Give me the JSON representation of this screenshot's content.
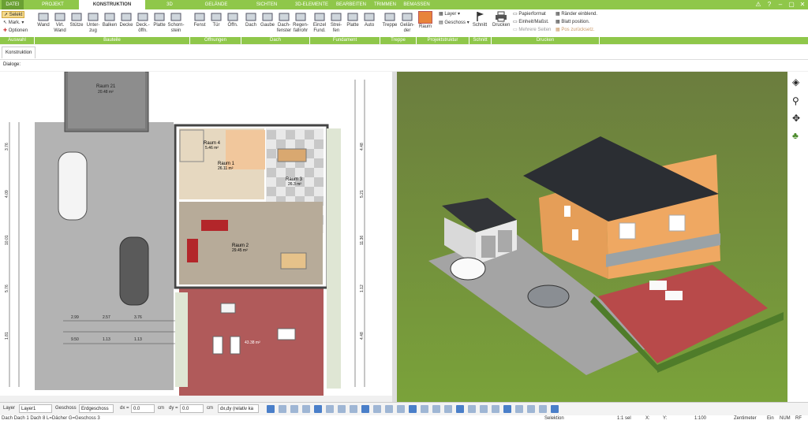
{
  "menu": {
    "tabs": [
      "DATEI",
      "PROJEKT",
      "KONSTRUKTION",
      "3D",
      "GELÄNDE",
      "SICHTEN",
      "3D-ELEMENTE",
      "BEARBEITEN",
      "TRIMMEN",
      "BEMASSEN"
    ],
    "active_tab": "KONSTRUKTION"
  },
  "ribbon": {
    "auswahl": {
      "selekt": "Selekt",
      "mark": "Mark.",
      "optionen": "Optionen"
    },
    "bauteile": [
      {
        "l1": "Wand",
        "l2": ""
      },
      {
        "l1": "Virt.",
        "l2": "Wand"
      },
      {
        "l1": "Stütze",
        "l2": ""
      },
      {
        "l1": "Unter-",
        "l2": "zug"
      },
      {
        "l1": "Balken",
        "l2": ""
      },
      {
        "l1": "Decke",
        "l2": ""
      },
      {
        "l1": "Deck.-",
        "l2": "öffn."
      },
      {
        "l1": "Platte",
        "l2": ""
      },
      {
        "l1": "Schorn-",
        "l2": "stein"
      }
    ],
    "oeffnungen": [
      {
        "l1": "Fenst",
        "l2": ""
      },
      {
        "l1": "Tür",
        "l2": ""
      },
      {
        "l1": "Öffn.",
        "l2": ""
      }
    ],
    "dach": [
      {
        "l1": "Dach",
        "l2": ""
      },
      {
        "l1": "Gaube",
        "l2": ""
      },
      {
        "l1": "Dach-",
        "l2": "fenster"
      },
      {
        "l1": "Regen-",
        "l2": "fallrohr"
      }
    ],
    "fundament": [
      {
        "l1": "Einzel",
        "l2": "Fund."
      },
      {
        "l1": "Strei-",
        "l2": "fen"
      },
      {
        "l1": "Platte",
        "l2": ""
      },
      {
        "l1": "Auto",
        "l2": ""
      }
    ],
    "treppe": [
      {
        "l1": "Treppe",
        "l2": ""
      },
      {
        "l1": "Gelän-",
        "l2": "der"
      }
    ],
    "projektstruktur": {
      "raum": "Raum",
      "layer": "Layer",
      "geschoss": "Geschoss"
    },
    "schnitt": {
      "label": "Schnitt"
    },
    "drucken": {
      "drucken": "Drucken",
      "papierformat": "Papierformat",
      "einheit": "Einheit/Maßst.",
      "mehrere": "Mehrere Seiten",
      "raender": "Ränder einblend.",
      "blatt": "Blatt position.",
      "pos": "Pos zurücksetz."
    },
    "groups": [
      "Auswahl",
      "Bauteile",
      "Öffnungen",
      "Dach",
      "Fundament",
      "Treppe",
      "Projektstruktur",
      "Schnitt",
      "Drucken"
    ]
  },
  "tabs": {
    "konstruktion": "Konstruktion",
    "dialoge": "Dialoge:"
  },
  "plan": {
    "rooms": [
      {
        "name": "Raum 21",
        "area": "20.48 m²"
      },
      {
        "name": "Raum 4",
        "area": "5.46 m²"
      },
      {
        "name": "Raum 1",
        "area": "26.11 m²"
      },
      {
        "name": "Raum 3",
        "area": "26.3 m²"
      },
      {
        "name": "Raum 2",
        "area": "29.45 m²"
      }
    ],
    "terrace_area": "43.38 m²",
    "dims_left": [
      "3.76",
      "4.09",
      "10.01",
      "5.76",
      "1.81"
    ],
    "dims_right": [
      "4.48",
      "5.21",
      "11.36",
      "1.12",
      "4.48"
    ],
    "dims_bottom": [
      "2.99",
      "2.57",
      "3.76",
      "9.50",
      "1.13",
      "1.13"
    ]
  },
  "statusbar": {
    "layer_label": "Layer",
    "layer_value": "Layer1",
    "geschoss_label": "Geschoss",
    "geschoss_value": "Erdgeschoss",
    "dx_label": "dx =",
    "dx_value": "0.0",
    "dx_unit": "cm",
    "dy_label": "dy =",
    "dy_value": "0.0",
    "dy_unit": "cm",
    "mode_value": "dx,dy (relativ ka"
  },
  "bottom": {
    "info": "Dach Dach 1 Dach 8 L=Dächer G=Geschoss 3",
    "selektion": "Selektion",
    "sel": "1:1 sel",
    "x": "X:",
    "y": "Y:",
    "scale": "1:100",
    "unit": "Zentimeter",
    "ein": "Ein",
    "num": "NUM",
    "rf": "RF"
  },
  "colors": {
    "brand": "#8fc74a",
    "grass": "#6b9a2e",
    "roof": "#2b2e33",
    "facade": "#e49a55",
    "terrace": "#b84a4a"
  }
}
